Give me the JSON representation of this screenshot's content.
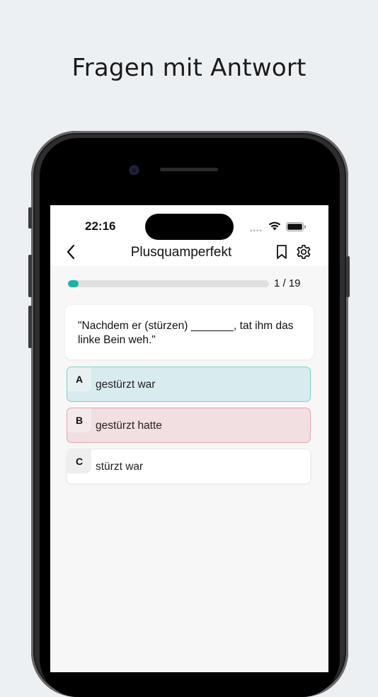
{
  "promo": {
    "title": "Fragen mit Antwort"
  },
  "status_bar": {
    "time": "22:16",
    "signal": "••••"
  },
  "navbar": {
    "title": "Plusquamperfekt",
    "back_icon": "chevron-left-icon",
    "bookmark_icon": "bookmark-icon",
    "settings_icon": "gear-icon"
  },
  "progress": {
    "label": "1 / 19",
    "current": 1,
    "total": 19,
    "fraction": 0.053,
    "color": "#1bb3a6"
  },
  "question": {
    "text": "\"Nachdem er (stürzen) _______, tat ihm das linke Bein weh.\""
  },
  "answers": [
    {
      "letter": "A",
      "text": "gestürzt war",
      "state": "correct",
      "color": "#d8ebee"
    },
    {
      "letter": "B",
      "text": "gestürzt hatte",
      "state": "wrong",
      "color": "#f2dfe1"
    },
    {
      "letter": "C",
      "text": "stürzt war",
      "state": "neutral",
      "color": "#ffffff"
    }
  ]
}
